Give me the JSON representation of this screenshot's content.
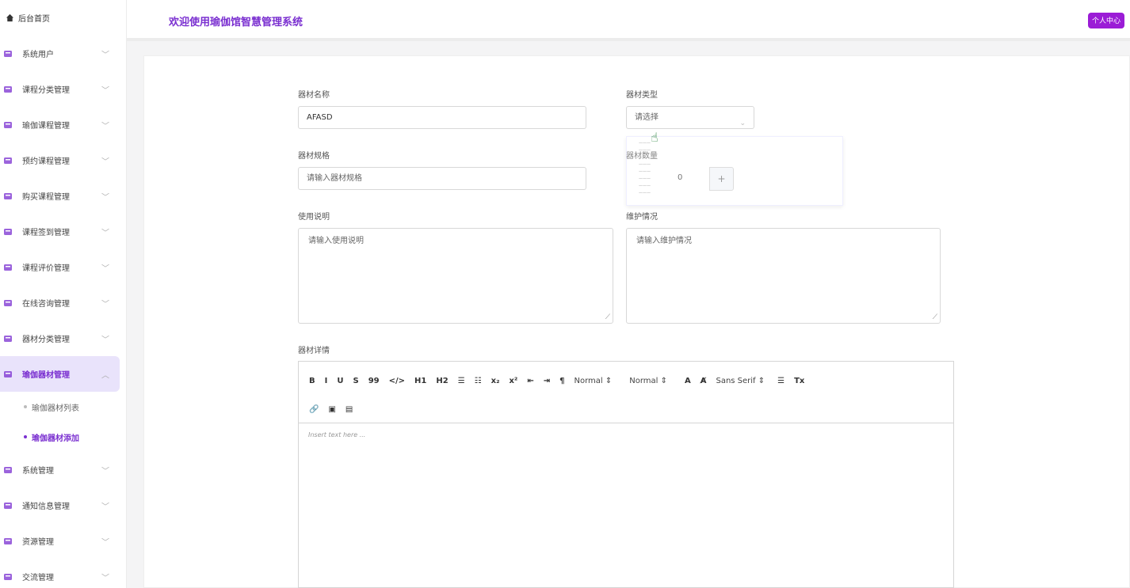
{
  "sidebar": {
    "home": "后台首页",
    "items": [
      {
        "label": "系统用户",
        "icon": "user-icon"
      },
      {
        "label": "课程分类管理",
        "icon": "tag-icon"
      },
      {
        "label": "瑜伽课程管理",
        "icon": "course-icon"
      },
      {
        "label": "预约课程管理",
        "icon": "calendar-icon"
      },
      {
        "label": "购买课程管理",
        "icon": "cart-icon"
      },
      {
        "label": "课程签到管理",
        "icon": "checkin-icon"
      },
      {
        "label": "课程评价管理",
        "icon": "star-icon"
      },
      {
        "label": "在线咨询管理",
        "icon": "list-icon"
      },
      {
        "label": "器材分类管理",
        "icon": "category-icon"
      },
      {
        "label": "瑜伽器材管理",
        "icon": "list-icon"
      }
    ],
    "subitems": [
      "瑜伽器材列表",
      "瑜伽器材添加"
    ],
    "items2": [
      {
        "label": "系统管理",
        "icon": "settings-icon"
      },
      {
        "label": "通知信息管理",
        "icon": "bell-icon"
      },
      {
        "label": "资源管理",
        "icon": "folder-icon"
      },
      {
        "label": "交流管理",
        "icon": "chat-icon"
      }
    ]
  },
  "header": {
    "title": "欢迎使用瑜伽馆智慧管理系统",
    "user_button": "个人中心"
  },
  "form": {
    "name_label": "器材名称",
    "name_value": "AFASD",
    "type_label": "器材类型",
    "type_placeholder": "请选择",
    "spec_label": "器材规格",
    "spec_placeholder": "请输入器材规格",
    "qty_label": "器材数量",
    "qty_value": "0",
    "usage_label": "使用说明",
    "usage_placeholder": "请输入使用说明",
    "maint_label": "维护情况",
    "maint_placeholder": "请输入维护情况",
    "detail_label": "器材详情",
    "editor_placeholder": "Insert text here ..."
  },
  "toolbar": {
    "row1": [
      "B",
      "I",
      "U",
      "S",
      "99",
      "</>",
      "H1",
      "H2",
      "☰",
      "☷",
      "x₂",
      "x²",
      "⇤",
      "⇥",
      "¶"
    ],
    "size_picker": "Normal",
    "header_picker": "Normal",
    "font_picker": "Sans Serif",
    "row2": [
      "🔗",
      "▣",
      "▤"
    ]
  },
  "colors": {
    "accent": "#7a2fd0",
    "button": "#9b1cd6"
  }
}
